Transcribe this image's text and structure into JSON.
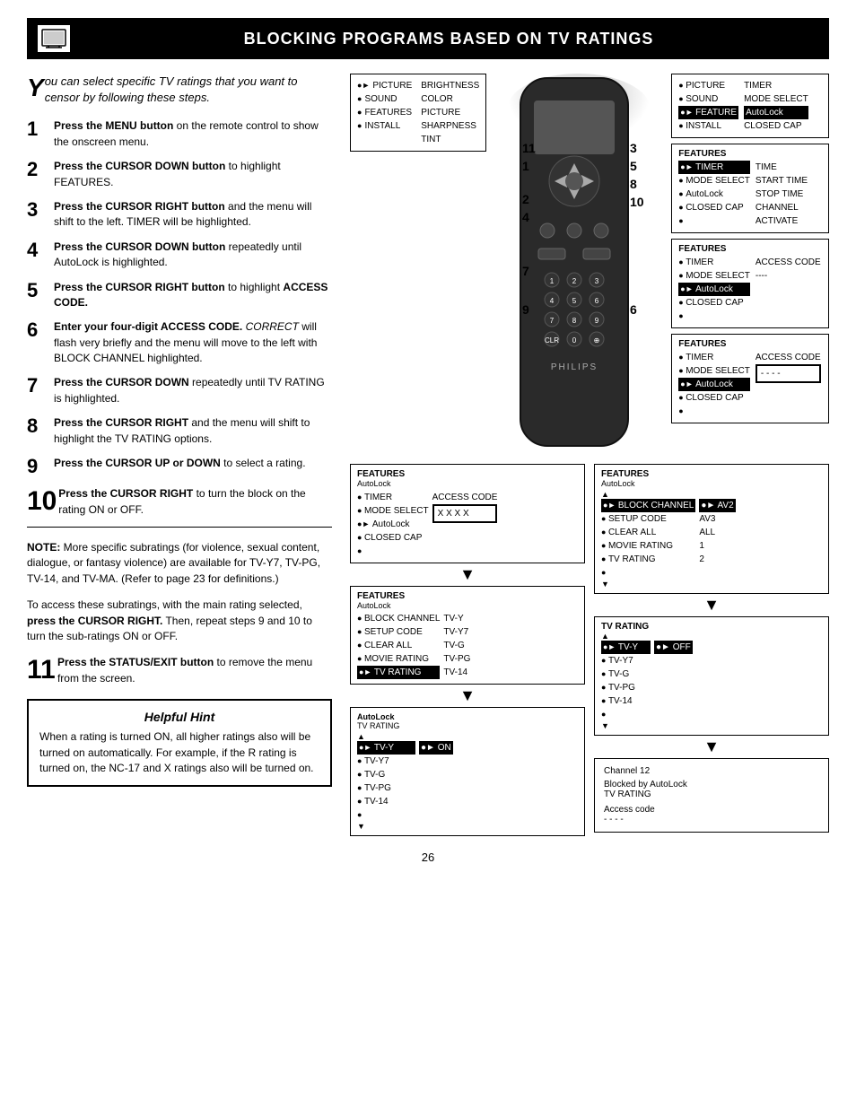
{
  "header": {
    "title": "Blocking Programs based on TV Ratings"
  },
  "intro": {
    "text": "ou can select specific TV ratings that you want to censor by following these steps."
  },
  "steps": [
    {
      "num": "1",
      "big": false,
      "html": "<strong>Press the MENU button</strong> on the remote control to show the onscreen menu."
    },
    {
      "num": "2",
      "big": false,
      "html": "<strong>Press the CURSOR DOWN button</strong> to highlight FEATURES."
    },
    {
      "num": "3",
      "big": false,
      "html": "<strong>Press the CURSOR RIGHT button</strong> and the menu will shift to the left. TIMER will be highlighted."
    },
    {
      "num": "4",
      "big": false,
      "html": "<strong>Press the CURSOR DOWN button</strong> repeatedly until AutoLock is highlighted."
    },
    {
      "num": "5",
      "big": false,
      "html": "<strong>Press the CURSOR RIGHT button</strong> to highlight <strong>ACCESS CODE.</strong>"
    },
    {
      "num": "6",
      "big": false,
      "html": "<strong>Enter your four-digit ACCESS CODE.</strong> <em>CORRECT</em> will flash very briefly and the menu will move to the left with BLOCK CHANNEL highlighted."
    },
    {
      "num": "7",
      "big": false,
      "html": "<strong>Press the CURSOR DOWN</strong> repeatedly until TV RATING is highlighted."
    },
    {
      "num": "8",
      "big": false,
      "html": "<strong>Press the CURSOR RIGHT</strong> and the menu will shift to highlight the TV RATING options."
    },
    {
      "num": "9",
      "big": false,
      "html": "<strong>Press the CURSOR UP or DOWN</strong> to select a rating."
    },
    {
      "num": "10",
      "big": true,
      "html": "<strong>Press the CURSOR RIGHT</strong> to turn the block on the rating ON or OFF."
    },
    {
      "num": "11",
      "big": true,
      "html": "<strong>Press the STATUS/EXIT button</strong> to remove the menu from the screen."
    }
  ],
  "note": {
    "bold": "NOTE:",
    "text": " More specific subratings (for violence, sexual content, dialogue, or fantasy violence) are available for TV-Y7, TV-PG, TV-14, and TV-MA. (Refer to page 23 for definitions.)"
  },
  "subrating": {
    "text": "To access these subratings, with the main rating selected, ",
    "bold": "press the CURSOR RIGHT.",
    "text2": " Then, repeat steps 9 and 10 to turn the sub-ratings ON or OFF."
  },
  "helpful_hint": {
    "title": "Helpful Hint",
    "text": "When a rating is turned ON, all higher ratings also will be turned on automatically.  For example, if the R rating is turned on, the NC-17 and X ratings also will be turned on."
  },
  "page_number": "26",
  "menus": {
    "menu1": {
      "title": "",
      "items": [
        {
          "bullet": "●►",
          "label": "PICTURE",
          "right": "BRIGHTNESS",
          "selected": false
        },
        {
          "bullet": "●",
          "label": "SOUND",
          "right": "COLOR",
          "selected": false
        },
        {
          "bullet": "●",
          "label": "FEATURES",
          "right": "PICTURE",
          "selected": false
        },
        {
          "bullet": "●",
          "label": "INSTALL",
          "right": "SHARPNESS",
          "selected": false
        },
        {
          "bullet": "",
          "label": "",
          "right": "TINT",
          "selected": false
        }
      ]
    },
    "menu2": {
      "items": [
        {
          "bullet": "●",
          "label": "PICTURE",
          "right": "TIMER",
          "selected": false
        },
        {
          "bullet": "●",
          "label": "SOUND",
          "right": "MODE SELECT",
          "selected": false
        },
        {
          "bullet": "●►",
          "label": "FEATURE",
          "right": "AutoLock",
          "selected": true
        },
        {
          "bullet": "●",
          "label": "INSTALL",
          "right": "CLOSED CAP",
          "selected": false
        }
      ]
    },
    "menu3": {
      "title": "FEATURES",
      "items": [
        {
          "bullet": "●►",
          "label": "TIMER",
          "right": "TIME",
          "selected": true
        },
        {
          "bullet": "●",
          "label": "MODE SELECT",
          "right": "START TIME",
          "selected": false
        },
        {
          "bullet": "●",
          "label": "AutoLock",
          "right": "STOP TIME",
          "selected": false
        },
        {
          "bullet": "●",
          "label": "CLOSED CAP",
          "right": "CHANNEL",
          "selected": false
        },
        {
          "bullet": "●",
          "label": "",
          "right": "ACTIVATE",
          "selected": false
        }
      ]
    },
    "menu4": {
      "title": "FEATURES",
      "items": [
        {
          "bullet": "●",
          "label": "TIMER",
          "right": "ACCESS CODE",
          "selected": false
        },
        {
          "bullet": "●",
          "label": "MODE SELECT",
          "right": "----",
          "selected": false
        },
        {
          "bullet": "●►",
          "label": "AutoLock",
          "right": "",
          "selected": true
        },
        {
          "bullet": "●",
          "label": "CLOSED CAP",
          "right": "",
          "selected": false
        },
        {
          "bullet": "●",
          "label": "",
          "right": "",
          "selected": false
        }
      ]
    },
    "menu5": {
      "title": "FEATURES",
      "items": [
        {
          "bullet": "●",
          "label": "TIMER",
          "right": "ACCESS CODE",
          "selected": false
        },
        {
          "bullet": "●",
          "label": "MODE SELECT",
          "right": "- - - -",
          "selected": false
        },
        {
          "bullet": "●►",
          "label": "AutoLock",
          "right": "",
          "selected": false
        },
        {
          "bullet": "●",
          "label": "CLOSED CAP",
          "right": "",
          "selected": false
        },
        {
          "bullet": "●",
          "label": "",
          "right": "",
          "selected": false
        }
      ],
      "access_code_highlighted": true
    },
    "menu6": {
      "title": "FEATURES",
      "subtitle": "AutoLock",
      "items": [
        {
          "bullet": "●►",
          "label": "BLOCK CHANNEL",
          "right": "●► AV2",
          "selected": true
        },
        {
          "bullet": "●",
          "label": "SETUP CODE",
          "right": "AV3",
          "selected": false
        },
        {
          "bullet": "●",
          "label": "CLEAR ALL",
          "right": "ALL",
          "selected": false
        },
        {
          "bullet": "●",
          "label": "MOVIE RATING",
          "right": "1",
          "selected": false
        },
        {
          "bullet": "●",
          "label": "TV RATING",
          "right": "2",
          "selected": false
        }
      ]
    },
    "menu7": {
      "title": "FEATURES",
      "subtitle": "AutoLock",
      "items": [
        {
          "bullet": "●",
          "label": "BLOCK CHANNEL",
          "right": "TV-Y",
          "selected": false
        },
        {
          "bullet": "●",
          "label": "SETUP CODE",
          "right": "TV-Y7",
          "selected": false
        },
        {
          "bullet": "●",
          "label": "CLEAR ALL",
          "right": "TV-G",
          "selected": false
        },
        {
          "bullet": "●",
          "label": "MOVIE RATING",
          "right": "TV-PG",
          "selected": false
        },
        {
          "bullet": "●►",
          "label": "TV RATING",
          "right": "TV-14",
          "selected": true
        }
      ]
    },
    "menu8_left": {
      "title": "FEATURES",
      "subtitle": "AutoLock",
      "access_code": "X X X X",
      "items": [
        {
          "bullet": "●",
          "label": "TIMER",
          "selected": false
        },
        {
          "bullet": "●",
          "label": "MODE SELECT",
          "selected": false
        },
        {
          "bullet": "●►",
          "label": "AutoLock",
          "selected": false
        },
        {
          "bullet": "●",
          "label": "CLOSED CAP",
          "selected": false
        },
        {
          "bullet": "●",
          "label": "",
          "selected": false
        }
      ]
    },
    "menu_tv_rating": {
      "title": "TV RATING",
      "items": [
        {
          "bullet": "●►",
          "label": "TV-Y",
          "right": "●► OFF",
          "selected": true
        },
        {
          "bullet": "●",
          "label": "TV-Y7",
          "right": "",
          "selected": false
        },
        {
          "bullet": "●",
          "label": "TV-G",
          "right": "",
          "selected": false
        },
        {
          "bullet": "●",
          "label": "TV-PG",
          "right": "",
          "selected": false
        },
        {
          "bullet": "●",
          "label": "TV-14",
          "right": "",
          "selected": false
        }
      ]
    },
    "menu_autolock_tvrating": {
      "title": "AutoLock",
      "subtitle": "TV RATING",
      "items": [
        {
          "bullet": "●►",
          "label": "TV-Y",
          "right": "●► ON",
          "selected": true
        },
        {
          "bullet": "●",
          "label": "TV-Y7",
          "right": "",
          "selected": false
        },
        {
          "bullet": "●",
          "label": "TV-G",
          "right": "",
          "selected": false
        },
        {
          "bullet": "●",
          "label": "TV-PG",
          "right": "",
          "selected": false
        },
        {
          "bullet": "●",
          "label": "TV-14",
          "right": "",
          "selected": false
        }
      ]
    },
    "menu_channel12": {
      "line1": "Channel 12",
      "line2": "Blocked by AutoLock",
      "line3": "TV RATING",
      "line4": "Access code",
      "line5": "- - - -"
    }
  }
}
